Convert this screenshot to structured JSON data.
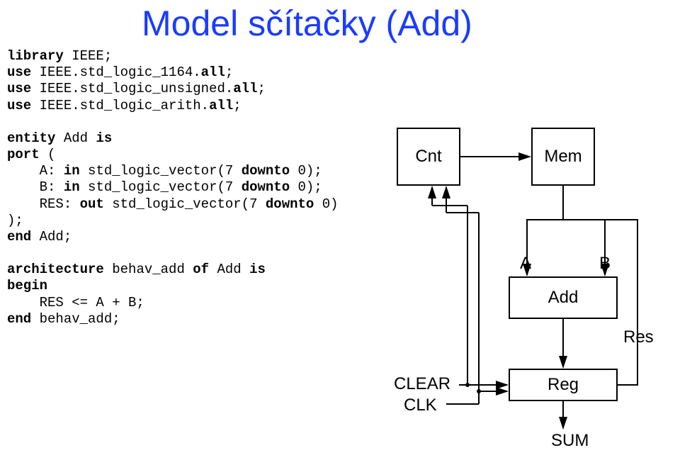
{
  "title": "Model sčítačky (Add)",
  "code": {
    "l01": "library IEEE;",
    "l02": "use IEEE.std_logic_1164.all;",
    "l03": "use IEEE.std_logic_unsigned.all;",
    "l04": "use IEEE.std_logic_arith.all;",
    "l05": "",
    "l06": "entity Add is",
    "l07": "port (",
    "l08": "    A: in std_logic_vector(7 downto 0);",
    "l09": "    B: in std_logic_vector(7 downto 0);",
    "l10": "    RES: out std_logic_vector(7 downto 0)",
    "l11": ");",
    "l12": "end Add;",
    "l13": "",
    "l14": "architecture behav_add of Add is",
    "l15": "begin",
    "l16": "    RES <= A + B;",
    "l17": "end behav_add;",
    "k_library": "library ",
    "k_ieee": "IEEE;",
    "k_use1": "use ",
    "k_pkg1": "IEEE.std_logic_1164.",
    "k_all": "all",
    "k_semi": ";",
    "k_pkg2": "IEEE.std_logic_unsigned.",
    "k_pkg3": "IEEE.std_logic_arith.",
    "k_entity": "entity ",
    "k_add": "Add ",
    "k_is": "is",
    "k_port": "port ",
    "k_paren_open": "(",
    "port_a": "    A: ",
    "k_in": "in",
    "port_a2": " std_logic_vector(7 ",
    "k_downto": "downto",
    "port_a3": " 0);",
    "port_b": "    B: ",
    "port_b2": " std_logic_vector(7 ",
    "port_b3": " 0);",
    "port_r": "    RES: ",
    "k_out": "out",
    "port_r2": " std_logic_vector(7 ",
    "port_r3": " 0)",
    "k_paren_close": ");",
    "k_end": "end ",
    "k_add2": "Add;",
    "k_arch": "architecture ",
    "arch_name": "behav_add ",
    "k_of": "of ",
    "arch_of": "Add ",
    "k_begin": "begin",
    "arch_body": "    RES <= A + B;",
    "arch_end": "behav_add;"
  },
  "diagram": {
    "cnt": "Cnt",
    "mem": "Mem",
    "add": "Add",
    "reg": "Reg",
    "a": "A",
    "b": "B",
    "res": "Res",
    "sum": "SUM",
    "clear": "CLEAR",
    "clk": "CLK"
  }
}
